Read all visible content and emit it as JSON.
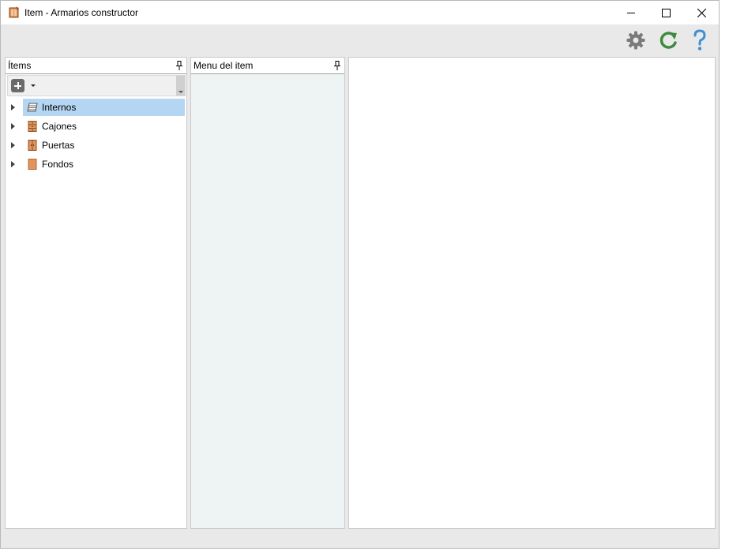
{
  "window": {
    "title": "Item - Armarios constructor"
  },
  "toolbar": {
    "buttons": [
      {
        "name": "settings",
        "icon": "gear-icon",
        "color": "#7a7a7a"
      },
      {
        "name": "refresh",
        "icon": "refresh-icon",
        "color": "#3d8b3d"
      },
      {
        "name": "help",
        "icon": "help-icon",
        "color": "#3f8fd2"
      }
    ]
  },
  "items_panel": {
    "title": "Ítems",
    "tree": [
      {
        "label": "Internos",
        "icon": "shelves-icon",
        "selected": true
      },
      {
        "label": "Cajones",
        "icon": "drawers-icon",
        "selected": false
      },
      {
        "label": "Puertas",
        "icon": "door-icon",
        "selected": false
      },
      {
        "label": "Fondos",
        "icon": "back-panel-icon",
        "selected": false
      }
    ]
  },
  "menu_panel": {
    "title": "Menu del item"
  },
  "colors": {
    "selection": "#b5d6f2",
    "menu_panel_bg": "#eef4f4",
    "wood": "#e3945a"
  }
}
